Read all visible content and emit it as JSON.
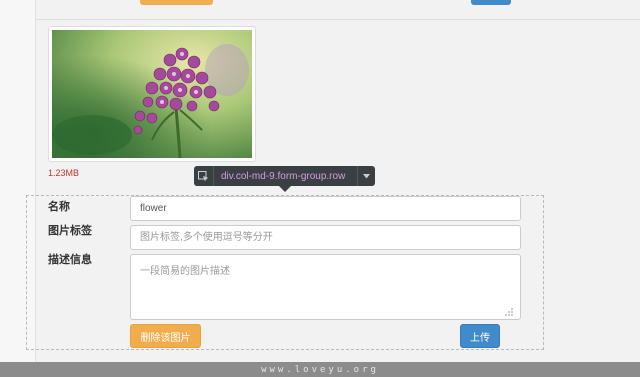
{
  "image_card": {
    "file_size": "1.23MB"
  },
  "inspector_tooltip": {
    "selector": "div.col-md-9.form-group.row"
  },
  "form": {
    "name_label": "名称",
    "name_value": "flower",
    "tags_label": "图片标签",
    "tags_placeholder": "图片标签,多个使用逗号等分开",
    "desc_label": "描述信息",
    "desc_placeholder": "一段简易的图片描述"
  },
  "actions": {
    "delete_label": "删除该图片",
    "upload_label": "上传"
  },
  "watermark": {
    "text": "www.loveyu.org"
  },
  "colors": {
    "warning": "#f0ad4e",
    "primary": "#428bca",
    "file_size": "#c0392b",
    "tooltip_bg": "#3a3f44",
    "tooltip_text": "#d79be0"
  },
  "icons": {
    "inspect": "inspect-element-icon",
    "caret": "caret-down-icon",
    "grip": "resize-grip-icon"
  }
}
